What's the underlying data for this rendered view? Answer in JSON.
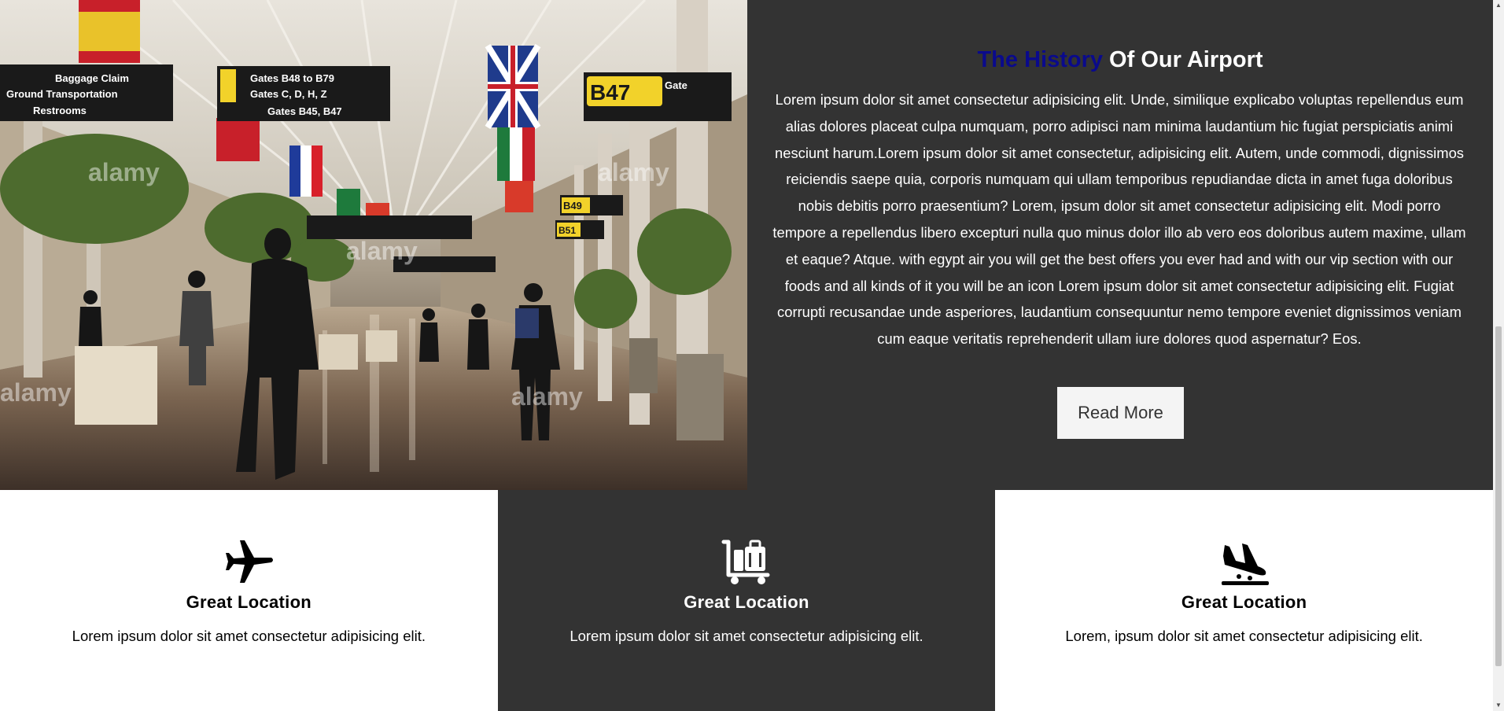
{
  "history": {
    "title_accent": "The History",
    "title_rest": " Of Our Airport",
    "body": "Lorem ipsum dolor sit amet consectetur adipisicing elit. Unde, similique explicabo voluptas repellendus eum alias dolores placeat culpa numquam, porro adipisci nam minima laudantium hic fugiat perspiciatis animi nesciunt harum.Lorem ipsum dolor sit amet consectetur, adipisicing elit. Autem, unde commodi, dignissimos reiciendis saepe quia, corporis numquam qui ullam temporibus repudiandae dicta in amet fuga doloribus nobis debitis porro praesentium? Lorem, ipsum dolor sit amet consectetur adipisicing elit. Modi porro tempore a repellendus libero excepturi nulla quo minus dolor illo ab vero eos doloribus autem maxime, ullam et eaque? Atque. with egypt air you will get the best offers you ever had and with our vip section with our foods and all kinds of it you will be an icon Lorem ipsum dolor sit amet consectetur adipisicing elit. Fugiat corrupti recusandae unde asperiores, laudantium consequuntur nemo tempore eveniet dignissimos veniam cum eaque veritatis reprehenderit ullam iure dolores quod aspernatur? Eos.",
    "button_label": "Read More",
    "accent_color": "#0a0a8c",
    "background_color": "#333333"
  },
  "photo": {
    "signs": {
      "baggage_claim": "Baggage Claim",
      "ground_transportation": "Ground Transportation",
      "restrooms": "Restrooms",
      "gates_1": "Gates B48 to B79",
      "gates_2": "Gates C, D, H, Z",
      "gates_3": "Gates B45, B47",
      "gate_number": "B47",
      "gate_word": "Gate",
      "gate_b49": "B49",
      "gate_b51": "B51"
    },
    "watermark": "alamy"
  },
  "features": [
    {
      "icon": "airplane-icon",
      "title": "Great Location",
      "text": "Lorem ipsum dolor sit amet consectetur adipisicing elit.",
      "theme": "light"
    },
    {
      "icon": "luggage-cart-icon",
      "title": "Great Location",
      "text": "Lorem ipsum dolor sit amet consectetur adipisicing elit.",
      "theme": "dark"
    },
    {
      "icon": "plane-landing-icon",
      "title": "Great Location",
      "text": "Lorem, ipsum dolor sit amet consectetur adipisicing elit.",
      "theme": "light"
    }
  ]
}
